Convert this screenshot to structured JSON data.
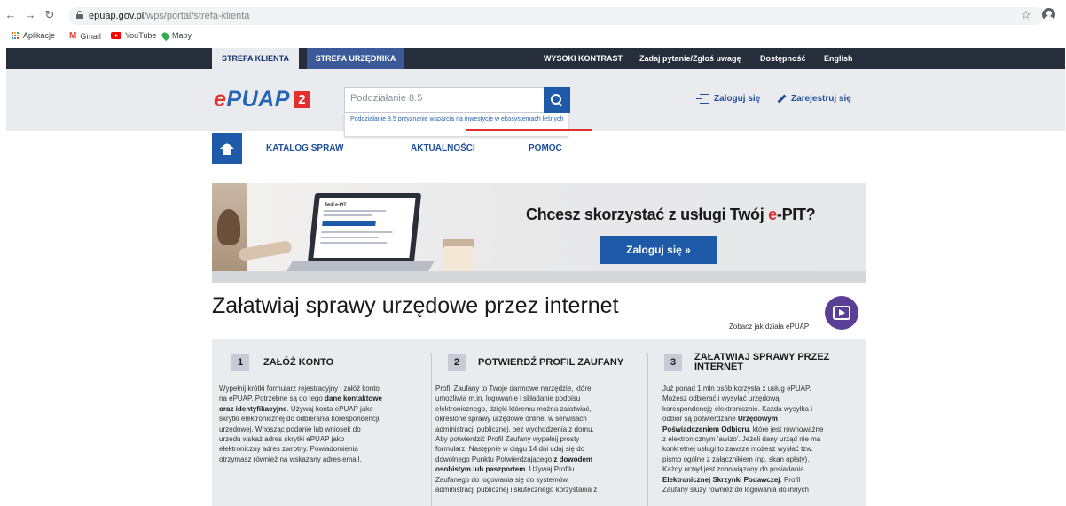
{
  "browser": {
    "url_domain": "epuap.gov.pl",
    "url_path": "/wps/portal/strefa-klienta",
    "bookmarks": [
      "Aplikacje",
      "Gmail",
      "YouTube",
      "Mapy"
    ],
    "icons": [
      "back-arrow-icon",
      "forward-arrow-icon",
      "reload-icon",
      "lock-icon",
      "star-icon",
      "profile-icon"
    ]
  },
  "topnav": {
    "tab_klient": "STREFA KLIENTA",
    "tab_urzednik": "STREFA URZĘDNIKA",
    "contrast": "WYSOKI KONTRAST",
    "question": "Zadaj pytanie/Zgłoś uwagę",
    "accessibility": "Dostępność",
    "english": "English"
  },
  "header": {
    "logo_text": "ePUAP",
    "logo_badge": "2",
    "search_value": "Poddziałanie 8.5",
    "suggestion": "Poddziałanie 8.5 przyznanie wsparcia na inwestycje w ekosystemach leśnych",
    "login": "Zaloguj się",
    "register": "Zarejestruj się"
  },
  "mainnav": {
    "items": [
      "KATALOG SPRAW",
      "AKTUALNOŚCI",
      "POMOC"
    ]
  },
  "banner": {
    "title_prefix": "Chcesz skorzystać z usługi Twój ",
    "title_highlight": "e",
    "title_suffix": "-PIT?",
    "button": "Zaloguj się »",
    "laptop_heading": "Twój e-PIT"
  },
  "main": {
    "title": "Załatwiaj sprawy urzędowe przez internet",
    "how_link": "Zobacz jak działa ePUAP"
  },
  "steps": [
    {
      "num": "1",
      "title": "ZAŁÓŻ KONTO",
      "body_html": "Wypełnij krótki formularz rejestracyjny i załóż konto<br>na ePUAP. Potrzebne są do tego <b>dane kontaktowe<br>oraz identyfikacyjne</b>. Używaj konta ePUAP jako<br>skrytki elektronicznej do odbierania korespondencji<br>urzędowej. Wnosząc podanie lub wniosek do<br>urzędu wskaż adres skrytki ePUAP jako<br>elektroniczny adres zwrotny. Powiadomienia<br>otrzymasz również na wskazany adres email."
    },
    {
      "num": "2",
      "title": "POTWIERDŹ PROFIL ZAUFANY",
      "body_html": "Profil Zaufany to Twoje darmowe narzędzie, które<br>umożliwia m.in. logowanie i składanie podpisu<br>elektronicznego, dzięki któremu można załatwiać,<br>określone sprawy urzędowe online, w serwisach<br>administracji publicznej, bez wychodzenia z domu.<br>Aby potwierdzić Profil Zaufany wypełnij prosty<br>formularz. Następnie w ciągu 14 dni udaj się do<br>dowolnego Punktu Potwierdzającego <b>z dowodem<br>osobistym lub paszportem</b>. Używaj Profilu<br>Zaufanego do logowania się do systemów<br>administracji publicznej i skutecznego korzystania z"
    },
    {
      "num": "3",
      "title": "ZAŁATWIAJ SPRAWY PRZEZ INTERNET",
      "body_html": "Już ponad 1 mln osób korzysta z usług ePUAP.<br>Możesz odbierać i wysyłać urzędową<br>korespondencję elektronicznie. Każda wysyłka i<br>odbiór są potwierdzane <b>Urzędowym<br>Poświadczeniem Odbioru</b>, które jest równoważne<br>z elektronicznym 'awizo'. Jeżeli dany urząd nie ma<br>konkretnej usługi to zawsze możesz wysłać tzw.<br>pismo ogólne z załącznikiem (np. skan opłaty).<br>Każdy urząd jest zobowiązany do posiadania<br><b>Elektronicznej Skrzynki Podawczej</b>. Profil<br>Zaufany służy również do logowania do innych"
    }
  ],
  "colors": {
    "topbar": "#262d3b",
    "brand_blue": "#1f5aa8",
    "accent_red": "#e2302c",
    "header_bg": "#e9ebee"
  }
}
